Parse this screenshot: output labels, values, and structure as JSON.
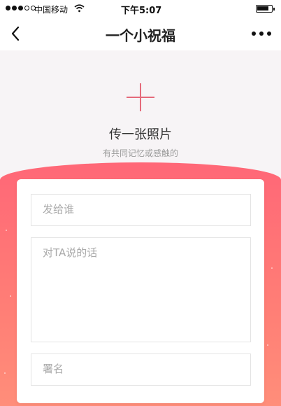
{
  "status": {
    "carrier": "中国移动",
    "time": "下午5:07"
  },
  "nav": {
    "title": "一个小祝福"
  },
  "upload": {
    "title": "传一张照片",
    "subtitle": "有共同记忆或感触的"
  },
  "form": {
    "recipient_placeholder": "发给谁",
    "message_placeholder": "对TA说的话",
    "signature_placeholder": "署名"
  },
  "colors": {
    "accent": "#e56a7a",
    "gradient_top": "#ff6777",
    "gradient_bottom": "#ff8f7a"
  }
}
